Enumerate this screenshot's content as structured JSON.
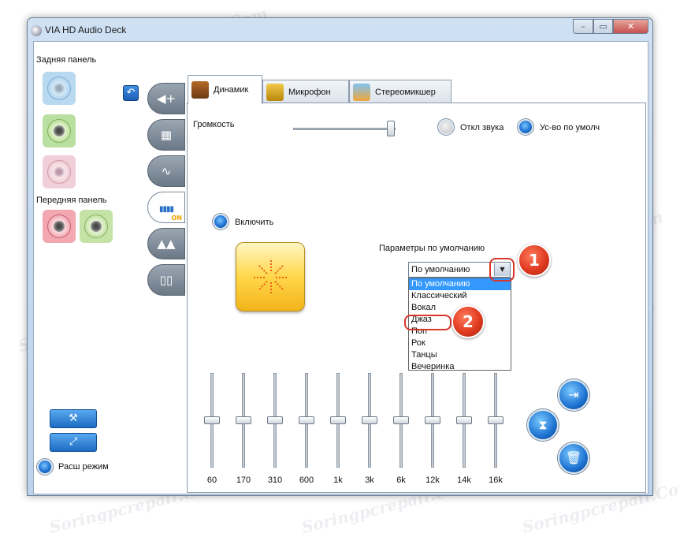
{
  "window": {
    "title": "VIA HD Audio Deck",
    "min_glyph": "–",
    "max_glyph": "▭",
    "close_glyph": "✕"
  },
  "left": {
    "rear_label": "Задняя панель",
    "front_label": "Передняя панель",
    "undo_glyph": "↶",
    "side_tabs": [
      {
        "icon": "speaker-volume-icon",
        "glyph": "◀+"
      },
      {
        "icon": "speaker-config-icon",
        "glyph": "▦"
      },
      {
        "icon": "waveform-icon",
        "glyph": "∿"
      },
      {
        "icon": "equalizer-icon",
        "glyph": "▮▮▮▮",
        "on": "ON"
      },
      {
        "icon": "environment-icon",
        "glyph": "▲▲"
      },
      {
        "icon": "room-calibration-icon",
        "glyph": "▯▯"
      }
    ],
    "mode_label": "Расш режим",
    "tool_glyphs": [
      "⚒",
      "⤢"
    ]
  },
  "tabs": [
    {
      "label": "Динамик",
      "active": true
    },
    {
      "label": "Микрофон",
      "active": false
    },
    {
      "label": "Стереомикшер",
      "active": false
    }
  ],
  "speaker": {
    "volume_label": "Громкость",
    "volume_level": 0.95,
    "mute_label": "Откл звука",
    "default_device_label": "Ус-во по умолч",
    "enable_label": "Включить",
    "preset_heading": "Параметры по умолчанию",
    "preset_value": "По умолчанию",
    "preset_options": [
      "По умолчанию",
      "Классический",
      "Вокал",
      "Джаз",
      "Поп",
      "Рок",
      "Танцы",
      "Вечеринка"
    ],
    "eq_bands": [
      "60",
      "170",
      "310",
      "600",
      "1k",
      "3k",
      "6k",
      "12k",
      "14k",
      "16k"
    ],
    "eq_levels": [
      0.5,
      0.5,
      0.5,
      0.5,
      0.5,
      0.5,
      0.5,
      0.5,
      0.5,
      0.5
    ]
  },
  "callouts": [
    "1",
    "2"
  ],
  "watermark": "Soringpcrepair.Com",
  "colors": {
    "accent": "#1f74d4",
    "callout": "#e03b20",
    "selection": "#3399ff"
  }
}
